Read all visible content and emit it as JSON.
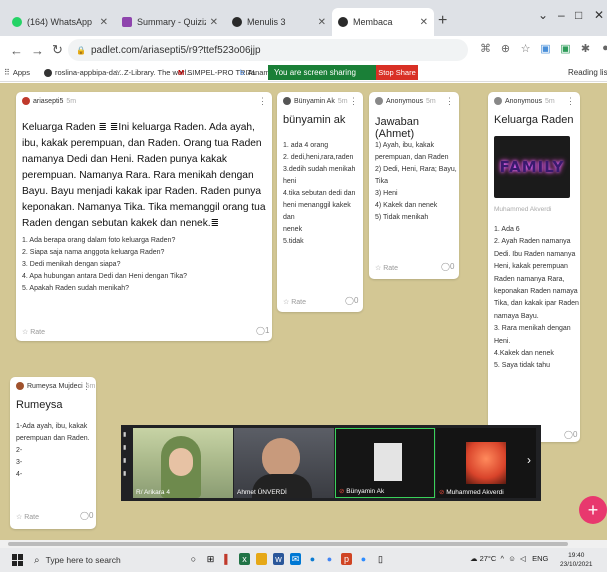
{
  "browser": {
    "tabs": [
      {
        "title": "(164) WhatsApp",
        "color": "#25d366"
      },
      {
        "title": "Summary - Quizizz",
        "color": "#8e44ad"
      },
      {
        "title": "Menulis 3",
        "color": "#2a2a2a"
      },
      {
        "title": "Membaca",
        "color": "#2a2a2a"
      }
    ],
    "new_tab": "+",
    "url": "padlet.com/ariasepti5/r9?ttef523o06jjp",
    "window_controls": [
      "⌄",
      "–",
      "□",
      "✕"
    ],
    "bookmarks": [
      {
        "label": "Apps"
      },
      {
        "label": "roslina-appbipa-da..."
      },
      {
        "label": "Z-Library. The worl..."
      },
      {
        "label": "SIMPEL-PRO TRIAL"
      },
      {
        "label": "Tanami"
      }
    ],
    "sharing_text": "You are screen sharing",
    "stop_share": "Stop Share",
    "reading_list": "Reading lis"
  },
  "cards": {
    "main": {
      "author": "ariasepti5",
      "time": "5m",
      "text": "Keluarga Raden ≣ ≣Ini keluarga Raden. Ada ayah, ibu, kakak perempuan, dan Raden. Orang tua Raden namanya Dedi dan Heni. Raden punya kakak perempuan. Namanya Rara. Rara menikah dengan Bayu. Bayu menjadi kakak ipar Raden. Raden punya keponakan. Namanya Tika. Tika memanggil orang tua Raden dengan sebutan kakek dan nenek.≣",
      "questions": [
        "1.  Ada berapa orang dalam foto keluarga Raden?",
        "2.  Siapa saja nama anggota keluarga Raden?",
        "3.  Dedi menikah dengan siapa?",
        "4.  Apa hubungan antara Dedi dan Heni dengan Tika?",
        "5.  Apakah Raden sudah menikah?"
      ],
      "rate": "Rate",
      "comments": "1"
    },
    "bunyamin": {
      "author": "Bünyamin Ak",
      "time": "5m",
      "title": "bünyamin ak",
      "lines": [
        "1. ada 4 orang",
        "2. dedi,heni,rara,raden",
        "3.dedih sudah menikah",
        "heni",
        "4.tika sebutan dedi dan",
        "heni menanggil kakek dan",
        "nenek",
        "5.tidak"
      ],
      "rate": "Rate",
      "comments": "0"
    },
    "anon1": {
      "author": "Anonymous",
      "time": "5m",
      "title": "Jawaban (Ahmet)",
      "lines": [
        "1) Ayah, ibu, kakak",
        "perempuan, dan Raden",
        "2) Dedi, Heni, Rara; Bayu,",
        "Tika",
        "3) Heni",
        "4) Kakek dan nenek",
        "5) Tidak menikah"
      ],
      "rate": "Rate",
      "comments": "0"
    },
    "anon2": {
      "author": "Anonymous",
      "time": "5m",
      "title": "Keluarga Raden",
      "image_text": "FAMILY",
      "caption": "Muhammed Akverdi",
      "lines": [
        "1. Ada 6",
        "2. Ayah Raden namanya",
        "Dedi. Ibu Raden namanya",
        "Heni,  kakak perempuan",
        "Raden namanya Rara,",
        "keponakan Raden namaya",
        "Tika, dan kakak ipar Raden",
        "namaya Bayu.",
        "3. Rara menikah dengan",
        "Heni.",
        "4.Kakek dan nenek",
        "5. Saya tidak tahu"
      ],
      "comments": "0"
    },
    "rumeysa": {
      "author": "Rumeysa Mujdeci",
      "time": "5m",
      "title": "Rumeysa",
      "lines": [
        "1-Ada ayah, ibu, kakak",
        "perempuan dan Raden.",
        "2-",
        "3-",
        "4-"
      ],
      "rate": "Rate",
      "comments": "0"
    }
  },
  "video": {
    "participants": [
      {
        "name": "R/ Arikara 4"
      },
      {
        "name": "Ahmet ÜNVERDİ"
      },
      {
        "name": "Bünyamin Ak"
      },
      {
        "name": "Muhammed Akverdi"
      }
    ],
    "next": "›"
  },
  "fab": "+",
  "taskbar": {
    "search": "Type here to search",
    "weather": "27°C",
    "lang": "ENG",
    "time": "19:40",
    "date": "23/10/2021"
  },
  "colors": {
    "board": "#d3c794",
    "fab": "#e8386e",
    "share_green": "#1a7f37",
    "stop_red": "#d93025"
  },
  "icons": [
    "back-arrow-icon",
    "forward-arrow-icon",
    "reload-icon",
    "lock-icon",
    "star-icon",
    "windows-icon",
    "search-icon",
    "chevron-right-icon",
    "plus-icon"
  ]
}
